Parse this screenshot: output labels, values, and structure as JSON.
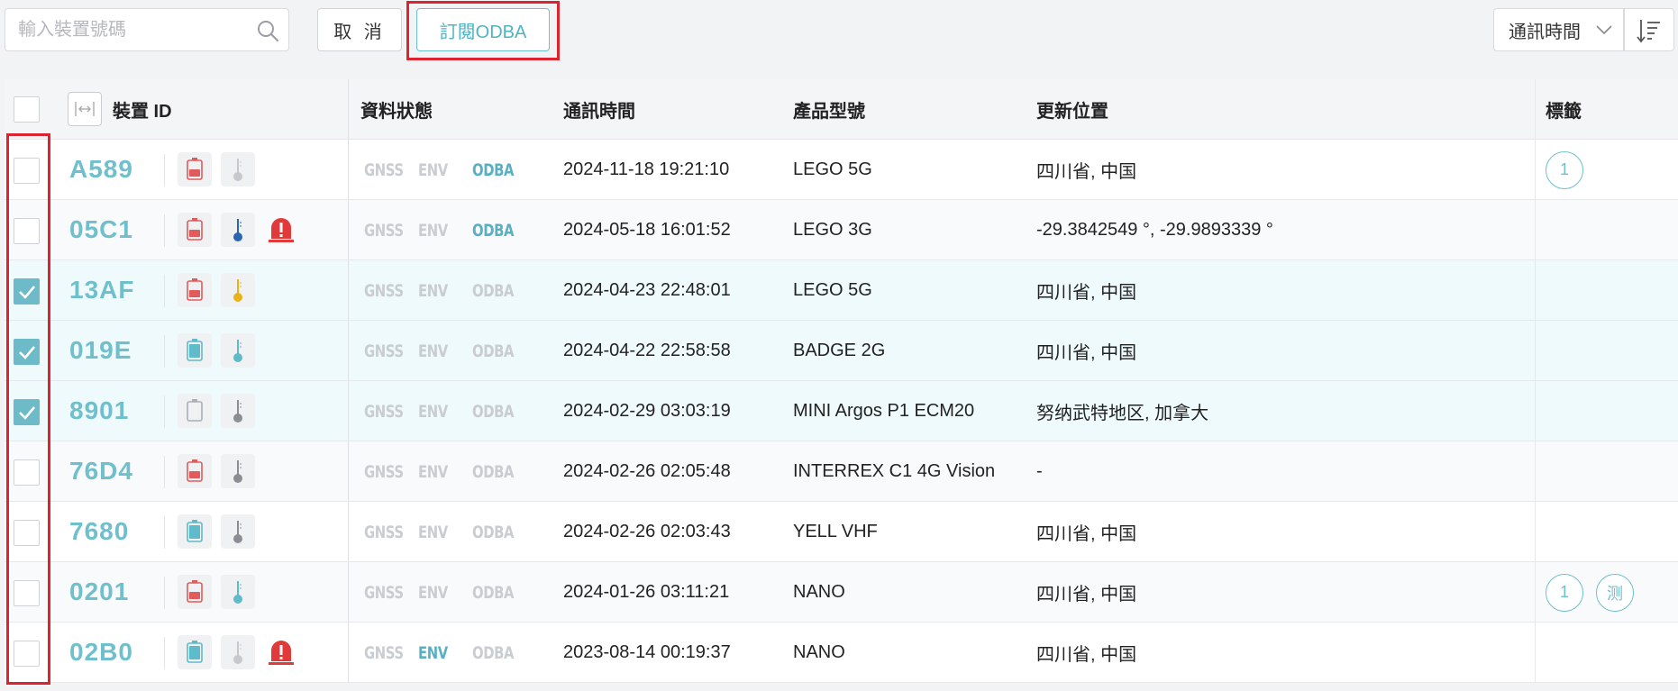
{
  "toolbar": {
    "search_placeholder": "輸入裝置號碼",
    "cancel_label": "取 消",
    "subscribe_label": "訂閱ODBA",
    "sort_field": "通訊時間"
  },
  "columns": {
    "device_id": "裝置 ID",
    "status": "資料狀態",
    "time": "通訊時間",
    "model": "產品型號",
    "location": "更新位置",
    "tags": "標籤"
  },
  "status_labels": [
    "GNSS",
    "ENV",
    "ODBA"
  ],
  "colors": {
    "accent": "#6fbfcc",
    "highlight": "#dc2330",
    "battery_low": "#e05c5c",
    "battery_ok": "#5fbac9"
  },
  "rows": [
    {
      "id": "A589",
      "checked": false,
      "battery": "low",
      "thermo": "light",
      "alarm": false,
      "gnss": false,
      "env": false,
      "odba": true,
      "time": "2024-11-18 19:21:10",
      "model": "LEGO 5G",
      "location": "四川省, 中国",
      "tags": [
        "1"
      ]
    },
    {
      "id": "05C1",
      "checked": false,
      "battery": "low",
      "thermo": "blue",
      "alarm": true,
      "gnss": false,
      "env": false,
      "odba": true,
      "time": "2024-05-18 16:01:52",
      "model": "LEGO 3G",
      "location": "-29.3842549 °, -29.9893339 °",
      "tags": []
    },
    {
      "id": "13AF",
      "checked": true,
      "battery": "low",
      "thermo": "yellow",
      "alarm": false,
      "gnss": false,
      "env": false,
      "odba": false,
      "time": "2024-04-23 22:48:01",
      "model": "LEGO 5G",
      "location": "四川省, 中国",
      "tags": []
    },
    {
      "id": "019E",
      "checked": true,
      "battery": "full",
      "thermo": "cyan",
      "alarm": false,
      "gnss": false,
      "env": false,
      "odba": false,
      "time": "2024-04-22 22:58:58",
      "model": "BADGE 2G",
      "location": "四川省, 中国",
      "tags": []
    },
    {
      "id": "8901",
      "checked": true,
      "battery": "empty",
      "thermo": "gray",
      "alarm": false,
      "gnss": false,
      "env": false,
      "odba": false,
      "time": "2024-02-29 03:03:19",
      "model": "MINI Argos P1 ECM20",
      "location": "努纳武特地区, 加拿大",
      "tags": []
    },
    {
      "id": "76D4",
      "checked": false,
      "battery": "low",
      "thermo": "gray",
      "alarm": false,
      "gnss": false,
      "env": false,
      "odba": false,
      "time": "2024-02-26 02:05:48",
      "model": "INTERREX C1 4G Vision",
      "location": "-",
      "tags": []
    },
    {
      "id": "7680",
      "checked": false,
      "battery": "full",
      "thermo": "gray",
      "alarm": false,
      "gnss": false,
      "env": false,
      "odba": false,
      "time": "2024-02-26 02:03:43",
      "model": "YELL VHF",
      "location": "四川省, 中国",
      "tags": []
    },
    {
      "id": "0201",
      "checked": false,
      "battery": "low",
      "thermo": "cyan",
      "alarm": false,
      "gnss": false,
      "env": false,
      "odba": false,
      "time": "2024-01-26 03:11:21",
      "model": "NANO",
      "location": "四川省, 中国",
      "tags": [
        "1",
        "测"
      ]
    },
    {
      "id": "02B0",
      "checked": false,
      "battery": "full",
      "thermo": "light",
      "alarm": true,
      "gnss": false,
      "env": true,
      "odba": false,
      "time": "2023-08-14 00:19:37",
      "model": "NANO",
      "location": "四川省, 中国",
      "tags": []
    }
  ]
}
